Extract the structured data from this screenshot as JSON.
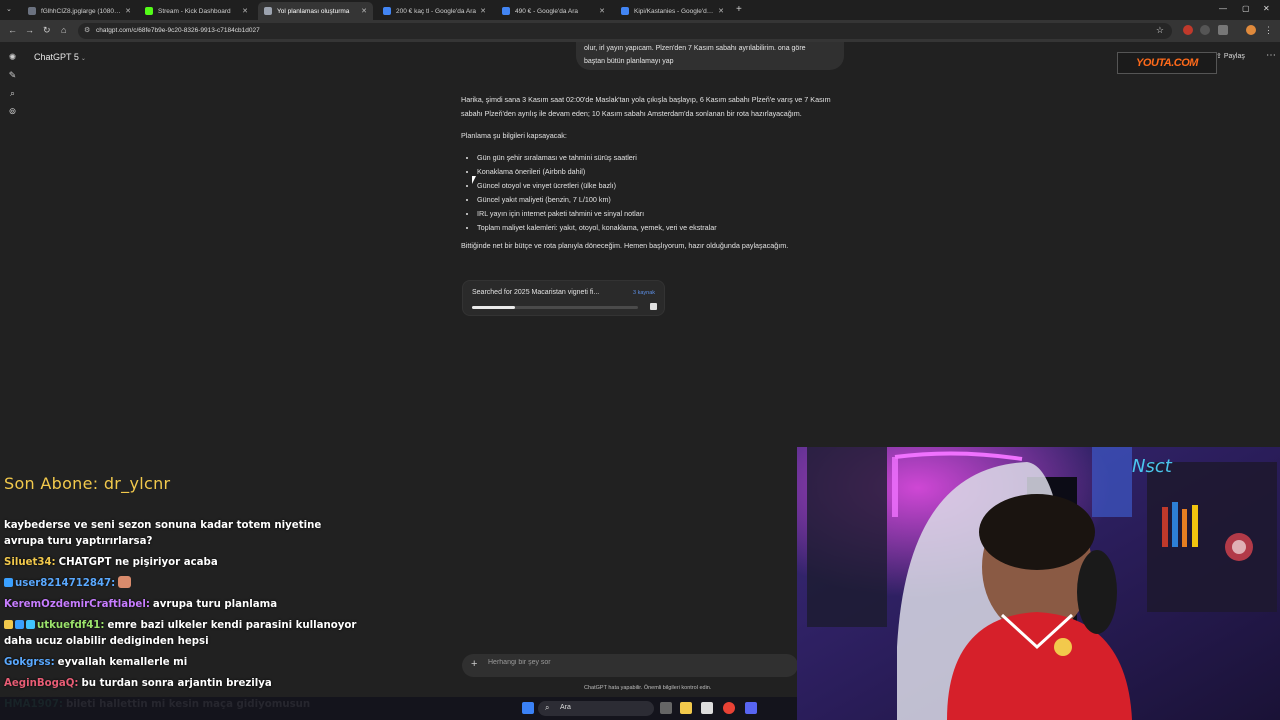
{
  "browser": {
    "tabs": [
      {
        "title": "fGlhhCIZ8.jpglarge (1080×1350)",
        "active": false,
        "favicon_color": "#6b7280"
      },
      {
        "title": "Stream - Kick Dashboard",
        "active": false,
        "favicon_color": "#53fc18"
      },
      {
        "title": "Yol planlaması oluşturma",
        "active": true,
        "favicon_color": "#9ca3af"
      },
      {
        "title": "200 € kaç tl - Google'da Ara",
        "active": false,
        "favicon_color": "#4285f4"
      },
      {
        "title": "490 € - Google'da Ara",
        "active": false,
        "favicon_color": "#4285f4"
      },
      {
        "title": "Kipi/Kastanies - Google'da Ara",
        "active": false,
        "favicon_color": "#4285f4"
      }
    ],
    "url": "chatgpt.com/c/68fe7b9e-9c20-8326-9913-c7184cb1d027"
  },
  "chatgpt": {
    "model": "ChatGPT 5",
    "share_label": "Paylaş",
    "user_message": [
      "olur, irl yayın yapıcam. Plzen'den 7 Kasım sabahı ayrılabilirim. ona göre",
      "baştan bütün planlamayı yap"
    ],
    "assistant": {
      "intro": "Harika, şimdi sana 3 Kasım saat 02:00'de Maslak'tan yola çıkışla başlayıp, 6 Kasım sabahı Plzeň'e varış ve 7 Kasım sabahı Plzeň'den ayrılış ile devam eden; 10 Kasım sabahı Amsterdam'da sonlanan bir rota hazırlayacağım.",
      "lead": "Planlama şu bilgileri kapsayacak:",
      "bullets": [
        "Gün gün şehir sıralaması ve tahmini sürüş saatleri",
        "Konaklama önerileri (Airbnb dahil)",
        "Güncel otoyol ve vinyet ücretleri (ülke bazlı)",
        "Güncel yakıt maliyeti (benzin, 7 L/100 km)",
        "IRL yayın için internet paketi tahmini ve sinyal notları",
        "Toplam maliyet kalemleri: yakıt, otoyol, konaklama, yemek, veri ve ekstralar"
      ],
      "closing": "Bittiğinde net bir bütçe ve rota planıyla döneceğim. Hemen başlıyorum, hazır olduğunda paylaşacağım."
    },
    "search_status": {
      "text": "Searched for 2025 Macaristan vigneti fi...",
      "sources": "3 kaynak",
      "progress": 0.26
    },
    "composer_placeholder": "Herhangi bir şey sor",
    "disclaimer": "ChatGPT hata yapabilir. Önemli bilgileri kontrol edin.",
    "watermark": "YOUTA.COM"
  },
  "overlay": {
    "last_sub": "Son Abone: dr_ylcnr",
    "chat": [
      {
        "user": "",
        "user_color": "#ffffff",
        "text": "kaybederse ve seni sezon sonuna kadar totem niyetine avrupa turu yaptırırlarsa?",
        "badges": []
      },
      {
        "user": "Siluet34:",
        "user_color": "#f2c94c",
        "text": "CHATGPT ne pişiriyor acaba",
        "badges": []
      },
      {
        "user": "user8214712847:",
        "user_color": "#5aa9ff",
        "text": "",
        "badges": [
          "#3aa0ff"
        ],
        "emote": true
      },
      {
        "user": "KeremOzdemirCraftlabel:",
        "user_color": "#c77dff",
        "text": "avrupa turu planlama",
        "badges": []
      },
      {
        "user": "utkuefdf41:",
        "user_color": "#9be26b",
        "text": "emre bazi ulkeler kendi parasini kullanoyor daha ucuz olabilir dediginden hepsi",
        "badges": [
          "#f2c94c",
          "#3aa0ff",
          "#40c4ff"
        ]
      },
      {
        "user": "Gokgrss:",
        "user_color": "#5aa9ff",
        "text": "eyvallah kemallerle mi",
        "badges": []
      },
      {
        "user": "AeginBogaQ:",
        "user_color": "#e85d75",
        "text": "bu turdan sonra arjantin brezilya",
        "badges": []
      },
      {
        "user": "HMA1907:",
        "user_color": "#4dd0a6",
        "text": "bileti hallettin mi kesin maça gidiyomusun",
        "badges": []
      }
    ]
  },
  "taskbar": {
    "search_label": "Ara"
  }
}
